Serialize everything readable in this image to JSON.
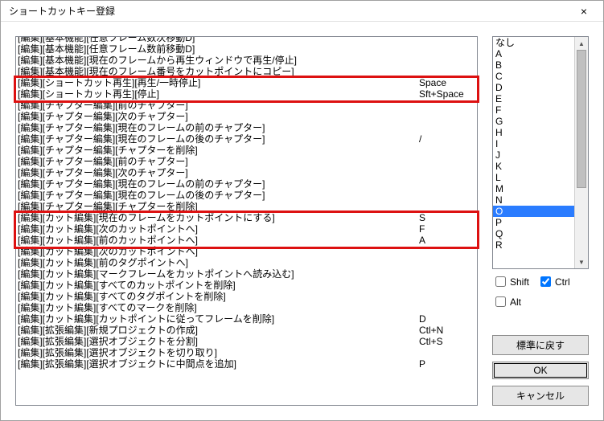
{
  "title": "ショートカットキー登録",
  "close_icon": "×",
  "rows": [
    {
      "label": "[編集][基本機能][任意フレーム数次移動D]",
      "key": ""
    },
    {
      "label": "[編集][基本機能][任意フレーム数前移動D]",
      "key": ""
    },
    {
      "label": "[編集][基本機能][現在のフレームから再生ウィンドウで再生/停止]",
      "key": ""
    },
    {
      "label": "[編集][基本機能][現在のフレーム番号をカットポイントにコピー]",
      "key": ""
    },
    {
      "label": "[編集][ショートカット再生][再生/一時停止]",
      "key": "Space"
    },
    {
      "label": "[編集][ショートカット再生][停止]",
      "key": "Sft+Space"
    },
    {
      "label": "[編集][チャプター編集][前のチャプター]",
      "key": ""
    },
    {
      "label": "[編集][チャプター編集][次のチャプター]",
      "key": ""
    },
    {
      "label": "[編集][チャプター編集][現在のフレームの前のチャプター]",
      "key": ""
    },
    {
      "label": "[編集][チャプター編集][現在のフレームの後のチャプター]",
      "key": "/"
    },
    {
      "label": "[編集][チャプター編集][チャプターを削除]",
      "key": ""
    },
    {
      "label": "[編集][チャプター編集][前のチャプター]",
      "key": ""
    },
    {
      "label": "[編集][チャプター編集][次のチャプター]",
      "key": ""
    },
    {
      "label": "[編集][チャプター編集][現在のフレームの前のチャプター]",
      "key": ""
    },
    {
      "label": "[編集][チャプター編集][現在のフレームの後のチャプター]",
      "key": ""
    },
    {
      "label": "[編集][チャプター編集][チャプターを削除]",
      "key": ""
    },
    {
      "label": "[編集][カット編集][現在のフレームをカットポイントにする]",
      "key": "S"
    },
    {
      "label": "[編集][カット編集][次のカットポイントへ]",
      "key": "F"
    },
    {
      "label": "[編集][カット編集][前のカットポイントへ]",
      "key": "A"
    },
    {
      "label": "[編集][カット編集][次のカットポイントへ]",
      "key": ""
    },
    {
      "label": "[編集][カット編集][前のタグポイントへ]",
      "key": ""
    },
    {
      "label": "[編集][カット編集][マークフレームをカットポイントへ読み込む]",
      "key": ""
    },
    {
      "label": "[編集][カット編集][すべてのカットポイントを削除]",
      "key": ""
    },
    {
      "label": "[編集][カット編集][すべてのタグポイントを削除]",
      "key": ""
    },
    {
      "label": "[編集][カット編集][すべてのマークを削除]",
      "key": ""
    },
    {
      "label": "[編集][カット編集][カットポイントに従ってフレームを削除]",
      "key": "D"
    },
    {
      "label": "[編集][拡張編集][新規プロジェクトの作成]",
      "key": "Ctl+N"
    },
    {
      "label": "[編集][拡張編集][選択オブジェクトを分割]",
      "key": "Ctl+S"
    },
    {
      "label": "[編集][拡張編集][選択オブジェクトを切り取り]",
      "key": ""
    },
    {
      "label": "[編集][拡張編集][選択オブジェクトに中間点を追加]",
      "key": "P"
    }
  ],
  "keys": [
    "なし",
    "A",
    "B",
    "C",
    "D",
    "E",
    "F",
    "G",
    "H",
    "I",
    "J",
    "K",
    "L",
    "M",
    "N",
    "O",
    "P",
    "Q",
    "R"
  ],
  "selected_key_index": 15,
  "mods": {
    "shift_label": "Shift",
    "ctrl_label": "Ctrl",
    "alt_label": "Alt",
    "shift": false,
    "ctrl": true,
    "alt": false
  },
  "buttons": {
    "reset": "標準に戻す",
    "ok": "OK",
    "cancel": "キャンセル"
  },
  "highlights": [
    {
      "start": 4,
      "end": 5
    },
    {
      "start": 16,
      "end": 18
    }
  ]
}
